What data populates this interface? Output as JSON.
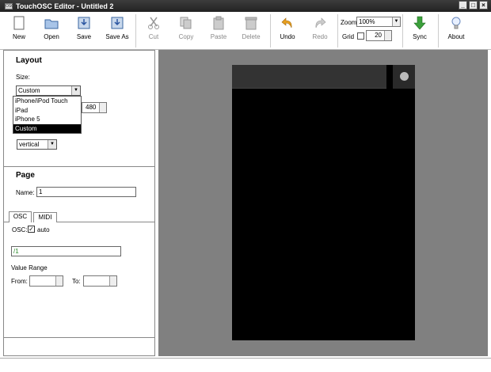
{
  "window": {
    "title": "TouchOSC Editor - Untitled 2",
    "app_icon": "OSC"
  },
  "toolbar": {
    "new": "New",
    "open": "Open",
    "save": "Save",
    "save_as": "Save As",
    "cut": "Cut",
    "copy": "Copy",
    "paste": "Paste",
    "delete": "Delete",
    "undo": "Undo",
    "redo": "Redo",
    "zoom_label": "Zoom",
    "zoom_value": "100%",
    "grid_label": "Grid",
    "grid_value": "20",
    "sync": "Sync",
    "about": "About"
  },
  "layout": {
    "title": "Layout",
    "size_label": "Size:",
    "size_value": "Custom",
    "size_options": [
      "iPhone/iPod Touch",
      "iPad",
      "iPhone 5",
      "Custom"
    ],
    "height_value": "480",
    "orientation_value": "vertical"
  },
  "page": {
    "title": "Page",
    "name_label": "Name:",
    "name_value": "1",
    "tabs": [
      "OSC",
      "MIDI"
    ],
    "osc_label": "OSC:",
    "osc_auto_label": "auto",
    "osc_checked": "✓",
    "osc_address": "/1",
    "value_range_label": "Value Range",
    "from_label": "From:",
    "to_label": "To:"
  },
  "colors": {
    "canvas_bg": "#808080",
    "device_bg": "#000000",
    "osc_address_color": "#2e8b2e",
    "sync_green": "#3ca03c",
    "undo_orange": "#e8a020"
  }
}
